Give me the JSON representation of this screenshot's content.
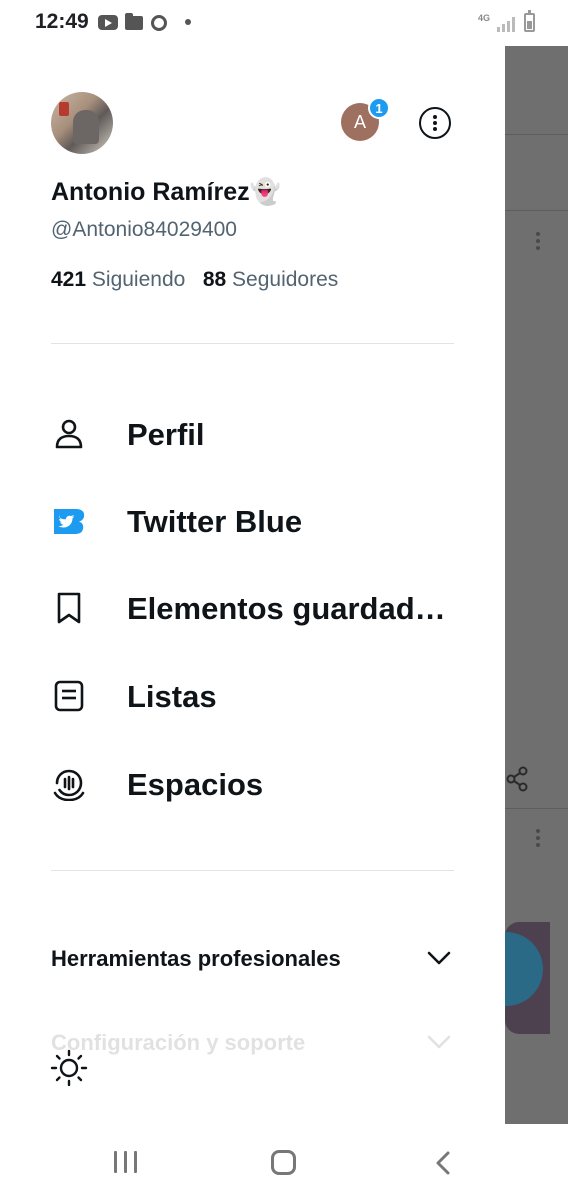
{
  "status_bar": {
    "time": "12:49",
    "network": "4G"
  },
  "profile": {
    "name": "Antonio Ramírez",
    "emoji": "👻",
    "handle": "@Antonio84029400",
    "following_count": "421",
    "following_label": "Siguiendo",
    "followers_count": "88",
    "followers_label": "Seguidores",
    "account_initial": "A",
    "account_badge": "1"
  },
  "menu": [
    {
      "label": "Perfil",
      "icon": "person-icon"
    },
    {
      "label": "Twitter Blue",
      "icon": "twitter-blue-icon"
    },
    {
      "label": "Elementos guardad…",
      "icon": "bookmark-icon"
    },
    {
      "label": "Listas",
      "icon": "list-icon"
    },
    {
      "label": "Espacios",
      "icon": "spaces-icon"
    }
  ],
  "sections": [
    {
      "label": "Herramientas profesionales"
    },
    {
      "label": "Configuración y soporte"
    }
  ],
  "colors": {
    "accent": "#1d9bf0",
    "text": "#0f1419",
    "secondary": "#536471",
    "backdrop": "#6f6f6f"
  }
}
